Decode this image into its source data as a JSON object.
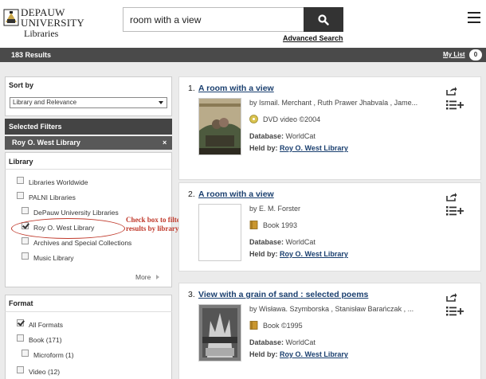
{
  "header": {
    "logo_line1": "DEPAUW",
    "logo_line2": "UNIVERSITY",
    "logo_line3": "Libraries",
    "search_value": "room with a view",
    "advanced_search": "Advanced Search"
  },
  "results_bar": {
    "count": "183 Results",
    "my_list": "My List",
    "my_list_count": "0"
  },
  "sidebar": {
    "sort_heading": "Sort by",
    "sort_value": "Library and Relevance",
    "selected_filters_heading": "Selected Filters",
    "selected_filter": "Roy O. West Library",
    "selected_filter_remove": "×",
    "library_heading": "Library",
    "libraries": [
      {
        "label": "Libraries Worldwide",
        "checked": false
      },
      {
        "label": "PALNI Libraries",
        "checked": false
      },
      {
        "label": "DePauw University Libraries",
        "checked": false
      },
      {
        "label": "Roy O. West Library",
        "checked": true
      },
      {
        "label": "Archives and Special Collections",
        "checked": false
      },
      {
        "label": "Music Library",
        "checked": false
      }
    ],
    "more": "More",
    "format_heading": "Format",
    "formats": [
      {
        "label": "All Formats",
        "checked": true
      },
      {
        "label": "Book (171)",
        "checked": false
      },
      {
        "label": "Microform (1)",
        "checked": false
      },
      {
        "label": "Video (12)",
        "checked": false
      }
    ],
    "annotation": "Check box to filter results by library"
  },
  "results": [
    {
      "num": "1.",
      "title": "A room with a view",
      "authors": "by Ismail. Merchant , Ruth Prawer Jhabvala , Jame...",
      "format": "DVD video ©2004",
      "format_icon": "dvd-icon",
      "db_label": "Database:",
      "db_value": "WorldCat",
      "held_label": "Held by:",
      "held_value": "Roy O. West Library"
    },
    {
      "num": "2.",
      "title": "A room with a view",
      "authors": "by E. M. Forster",
      "format": "Book 1993",
      "format_icon": "book-icon",
      "db_label": "Database:",
      "db_value": "WorldCat",
      "held_label": "Held by:",
      "held_value": "Roy O. West Library"
    },
    {
      "num": "3.",
      "title": "View with a grain of sand : selected poems",
      "authors": "by Wisława. Szymborska , Stanisław Barańczak , ...",
      "format": "Book ©1995",
      "format_icon": "book-icon",
      "db_label": "Database:",
      "db_value": "WorldCat",
      "held_label": "Held by:",
      "held_value": "Roy O. West Library"
    }
  ],
  "colors": {
    "dark_bar": "#4a4a4a",
    "link_blue": "#1a3f6f",
    "annotation_red": "#c0392b"
  }
}
